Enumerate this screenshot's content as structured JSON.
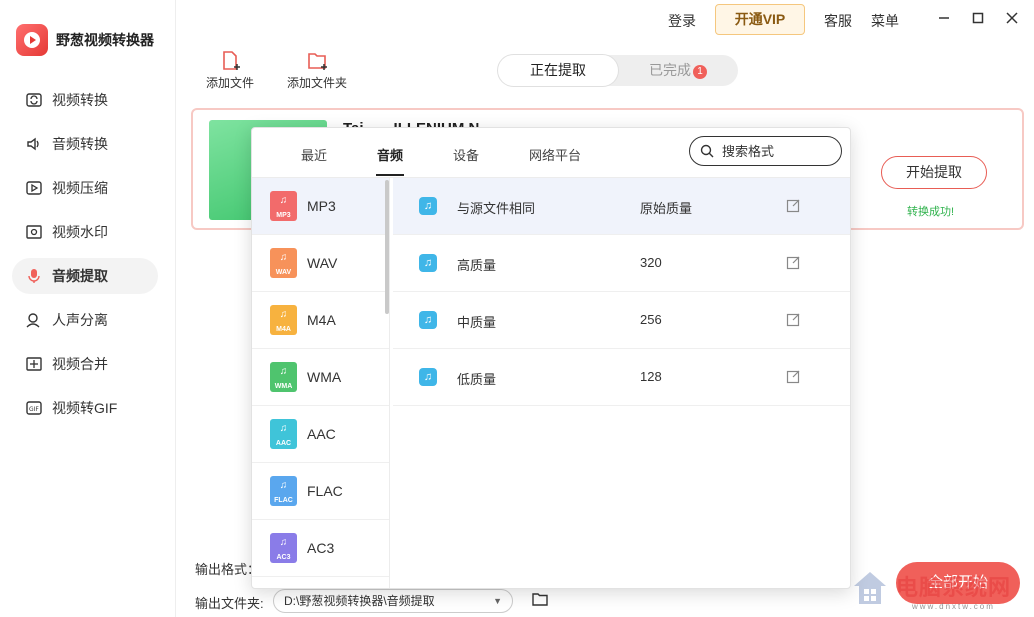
{
  "app": {
    "name": "野葱视频转换器"
  },
  "sidebar": {
    "items": [
      {
        "label": "视频转换",
        "icon": "video-convert-icon"
      },
      {
        "label": "音频转换",
        "icon": "audio-convert-icon"
      },
      {
        "label": "视频压缩",
        "icon": "video-compress-icon"
      },
      {
        "label": "视频水印",
        "icon": "video-watermark-icon"
      },
      {
        "label": "音频提取",
        "icon": "audio-extract-icon",
        "active": true
      },
      {
        "label": "人声分离",
        "icon": "vocal-separation-icon"
      },
      {
        "label": "视频合并",
        "icon": "video-merge-icon"
      },
      {
        "label": "视频转GIF",
        "icon": "video-to-gif-icon"
      }
    ]
  },
  "topbar": {
    "login": "登录",
    "vip": "开通VIP",
    "service": "客服",
    "menu": "菜单"
  },
  "toolbar": {
    "add_file": "添加文件",
    "add_folder": "添加文件夹"
  },
  "tabs": {
    "extracting": "正在提取",
    "done": "已完成",
    "done_count": "1"
  },
  "card": {
    "title": "Tai……ILLENIUM N…",
    "start": "开始提取",
    "status": "转换成功!"
  },
  "popup": {
    "tabs": [
      "最近",
      "音频",
      "设备",
      "网络平台"
    ],
    "active_tab": "音频",
    "search_placeholder": "搜索格式",
    "formats": [
      {
        "name": "MP3",
        "color": "#f26b6b"
      },
      {
        "name": "WAV",
        "color": "#f7925a"
      },
      {
        "name": "M4A",
        "color": "#f7b23f"
      },
      {
        "name": "WMA",
        "color": "#4fc46e"
      },
      {
        "name": "AAC",
        "color": "#3fc4d9"
      },
      {
        "name": "FLAC",
        "color": "#5aa7ee"
      },
      {
        "name": "AC3",
        "color": "#8a7ce8"
      }
    ],
    "qualities": [
      {
        "name": "与源文件相同",
        "value": "原始质量"
      },
      {
        "name": "高质量",
        "value": "320"
      },
      {
        "name": "中质量",
        "value": "256"
      },
      {
        "name": "低质量",
        "value": "128"
      }
    ]
  },
  "bottom": {
    "format_label": "输出格式：",
    "folder_label": "输出文件夹:",
    "path": "D:\\野葱视频转换器\\音频提取",
    "start_all": "全部开始"
  },
  "watermark": {
    "text": "电脑系统网",
    "sub": "www.dnxtw.com"
  }
}
